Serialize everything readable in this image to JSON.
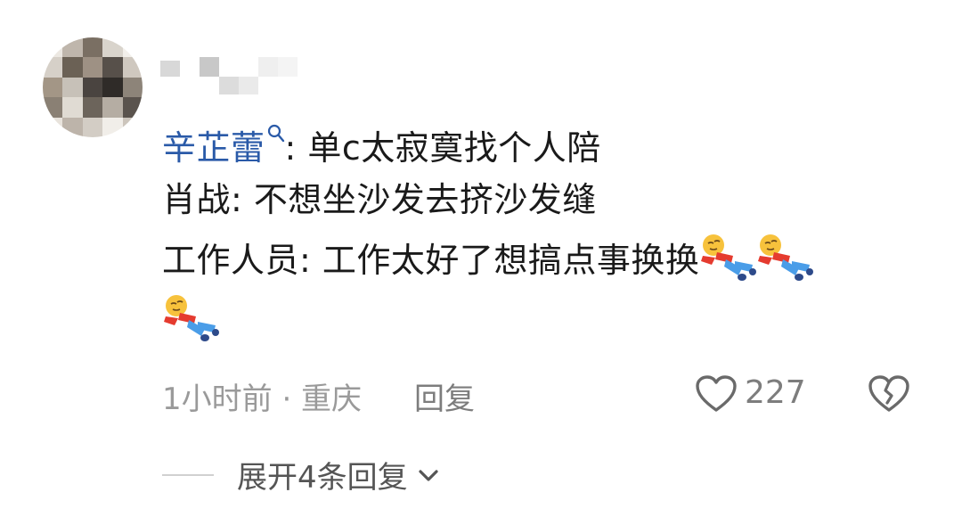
{
  "comment": {
    "avatar_icon": "blurred-avatar",
    "username_icon": "blurred-username",
    "line1": {
      "mention": "辛芷蕾",
      "mention_icon": "search-icon",
      "text": ": 单c太寂寞找个人陪"
    },
    "line2": {
      "text": "肖战: 不想坐沙发去挤沙发缝"
    },
    "line3": {
      "text": "工作人员: 工作太好了想搞点事换换",
      "emoji_icon": "lying-down-emoji"
    },
    "meta": "1小时前 · 重庆",
    "reply_label": "回复",
    "like_icon": "heart-icon",
    "like_count": "227",
    "dislike_icon": "broken-heart-icon",
    "expand_label": "展开4条回复",
    "expand_icon": "chevron-down-icon"
  }
}
